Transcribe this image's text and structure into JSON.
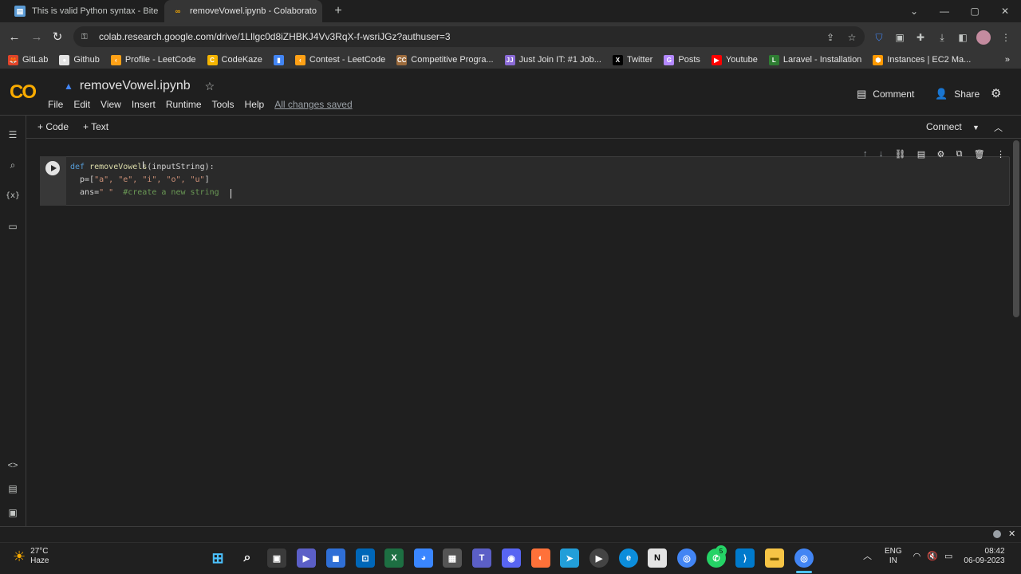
{
  "tabs": [
    {
      "title": "This is valid Python syntax - Bite",
      "favicon": "web-icon"
    },
    {
      "title": "removeVowel.ipynb - Colaborato",
      "favicon": "colab-icon"
    }
  ],
  "window_controls": {
    "new_tab": "+",
    "chevron": "⌄",
    "minimize": "—",
    "maximize": "▢",
    "close": "✕"
  },
  "address_bar": {
    "url": "colab.research.google.com/drive/1Lllgc0d8iZHBKJ4Vv3RqX-f-wsriJGz?authuser=3"
  },
  "bookmarks": [
    {
      "label": "GitLab",
      "color": "#e24329",
      "glyph": "🦊"
    },
    {
      "label": "Github",
      "color": "#e3e3e3",
      "glyph": "●"
    },
    {
      "label": "Profile - LeetCode",
      "color": "#ffa116",
      "glyph": "‹"
    },
    {
      "label": "CodeKaze",
      "color": "#f4b400",
      "glyph": "C"
    },
    {
      "label": "",
      "color": "#4285f4",
      "glyph": "▮"
    },
    {
      "label": "Contest - LeetCode",
      "color": "#ffa116",
      "glyph": "‹"
    },
    {
      "label": "Competitive Progra...",
      "color": "#9c6b3c",
      "glyph": "CC"
    },
    {
      "label": "Just Join IT: #1 Job...",
      "color": "#8a6ad6",
      "glyph": "JJ"
    },
    {
      "label": "Twitter",
      "color": "#000000",
      "glyph": "X"
    },
    {
      "label": "Posts",
      "color": "#b388ff",
      "glyph": "G"
    },
    {
      "label": "Youtube",
      "color": "#ff0000",
      "glyph": "▶"
    },
    {
      "label": "Laravel - Installation",
      "color": "#2e7d32",
      "glyph": "L"
    },
    {
      "label": "Instances | EC2 Ma...",
      "color": "#ff9900",
      "glyph": "⬢"
    }
  ],
  "colab": {
    "logo": "CO",
    "notebook_title": "removeVowel.ipynb",
    "menus": [
      "File",
      "Edit",
      "View",
      "Insert",
      "Runtime",
      "Tools",
      "Help"
    ],
    "save_status": "All changes saved",
    "comment_label": "Comment",
    "share_label": "Share",
    "add_code_label": "+ Code",
    "add_text_label": "+ Text",
    "connect_label": "Connect"
  },
  "cell": {
    "lines": [
      {
        "kw": "def",
        "fn": "removeVowels",
        "rest": "(inputString):"
      },
      {
        "text": "  p=[",
        "strings": "\"a\", \"e\", \"i\", \"o\", \"u\"",
        "end": "]"
      },
      {
        "text": "  ans=",
        "string": "\" \"",
        "comment": "  #create a new string"
      }
    ]
  },
  "taskbar": {
    "temperature": "27°C",
    "condition": "Haze",
    "language": "ENG",
    "region": "IN",
    "time": "08:42",
    "date": "06-09-2023",
    "notification_badge": "5"
  },
  "colors": {
    "accent_orange": "#f9ab00",
    "accent_dark_orange": "#e8710a",
    "background": "#1f1f1f"
  }
}
